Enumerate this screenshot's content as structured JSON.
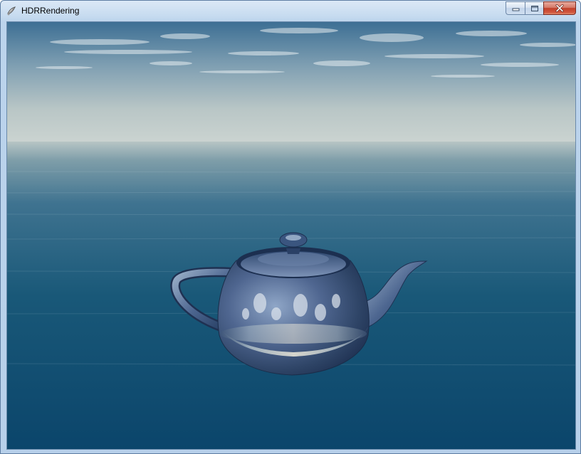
{
  "window": {
    "title": "HDRRendering"
  },
  "titlebar": {
    "icons": {
      "app": "app-icon",
      "minimize": "minimize-icon",
      "maximize": "maximize-icon",
      "close": "close-icon"
    }
  },
  "scene": {
    "object": "teapot",
    "environment": "sky-and-ocean",
    "colors": {
      "sky_top": "#3d6f94",
      "horizon": "#c9d3d2",
      "ocean_near": "#0c4a70"
    }
  }
}
